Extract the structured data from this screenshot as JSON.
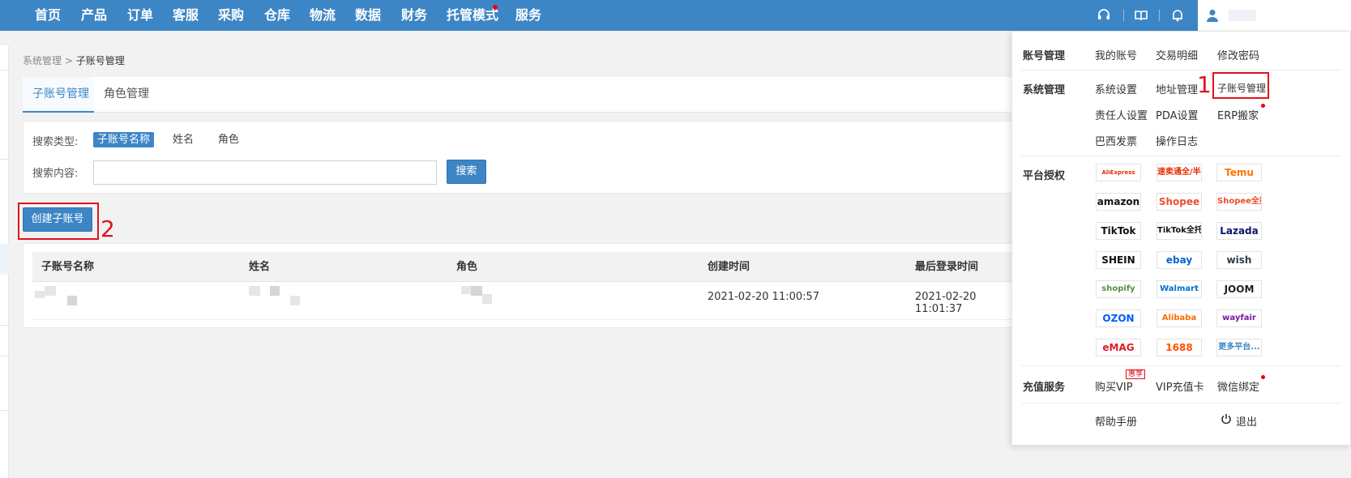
{
  "nav": {
    "items": [
      "首页",
      "产品",
      "订单",
      "客服",
      "采购",
      "仓库",
      "物流",
      "数据",
      "财务",
      "托管模式",
      "服务"
    ]
  },
  "icons": {
    "headset": "headset-icon",
    "book": "book-icon",
    "bell": "bell-icon",
    "user": "user-icon",
    "chevron": "chevron-right-icon",
    "power": "power-icon"
  },
  "colors": {
    "nav_bg": "#3d86c6",
    "accent": "#3d86c6",
    "annotation": "#e0121e"
  },
  "breadcrumb": {
    "parent": "系统管理",
    "separator": ">",
    "current": "子账号管理"
  },
  "tabs": [
    "子账号管理",
    "角色管理"
  ],
  "search": {
    "type_label": "搜索类型:",
    "types": [
      "子账号名称",
      "姓名",
      "角色"
    ],
    "content_label": "搜索内容:",
    "input_value": "",
    "button": "搜索"
  },
  "create_button": "创建子账号",
  "annotations": [
    "1",
    "2"
  ],
  "table": {
    "columns": [
      "子账号名称",
      "姓名",
      "角色",
      "创建时间",
      "最后登录时间"
    ],
    "rows": [
      {
        "created": "2021-02-20 11:00:57",
        "last_login": "2021-02-20 11:01:37"
      }
    ]
  },
  "dropdown": {
    "account_mgmt": {
      "title": "账号管理",
      "links": [
        "我的账号",
        "交易明细",
        "修改密码"
      ]
    },
    "system_mgmt": {
      "title": "系统管理",
      "links": [
        "系统设置",
        "地址管理",
        "子账号管理",
        "责任人设置",
        "PDA设置",
        "ERP搬家",
        "巴西发票",
        "操作日志"
      ]
    },
    "platform_auth": {
      "title": "平台授权",
      "platforms": [
        {
          "name": "AliExpress",
          "color": "#e62e04"
        },
        {
          "name": "速卖通全/半托管",
          "color": "#e62e04"
        },
        {
          "name": "Temu",
          "color": "#fb7701"
        },
        {
          "name": "amazon",
          "color": "#111111"
        },
        {
          "name": "Shopee",
          "color": "#ee4d2d"
        },
        {
          "name": "Shopee全托管",
          "color": "#ee4d2d"
        },
        {
          "name": "TikTok",
          "color": "#111111"
        },
        {
          "name": "TikTok全托管",
          "color": "#111111"
        },
        {
          "name": "Lazada",
          "color": "#0f146d"
        },
        {
          "name": "SHEIN",
          "color": "#111111"
        },
        {
          "name": "ebay",
          "color": "#0064d2"
        },
        {
          "name": "wish",
          "color": "#2f3e46"
        },
        {
          "name": "shopify",
          "color": "#5e8e3e"
        },
        {
          "name": "Walmart",
          "color": "#0071ce"
        },
        {
          "name": "JOOM",
          "color": "#222222"
        },
        {
          "name": "OZON",
          "color": "#005bff"
        },
        {
          "name": "Alibaba",
          "color": "#ff6a00"
        },
        {
          "name": "wayfair",
          "color": "#7b189f"
        },
        {
          "name": "eMAG",
          "color": "#d91f26"
        },
        {
          "name": "1688",
          "color": "#ff5000"
        },
        {
          "name": "更多平台...",
          "color": "#3d86c6"
        }
      ]
    },
    "recharge": {
      "title": "充值服务",
      "links": [
        "购买VIP",
        "VIP充值卡",
        "微信绑定"
      ],
      "badge": "惠享"
    },
    "help": "帮助手册",
    "logout": "退出"
  }
}
